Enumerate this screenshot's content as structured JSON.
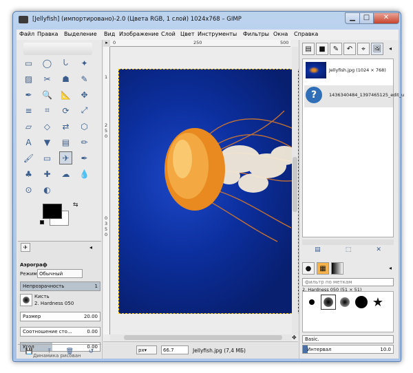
{
  "window": {
    "title": "[Jellyfish] (импортировано)-2.0 (Цвета RGB, 1 слой) 1024x768 – GIMP",
    "minimize": "▁",
    "maximize": "□",
    "close": "✕"
  },
  "menu": [
    "Файл",
    "Правка",
    "Выделение",
    "Вид",
    "Изображение",
    "Слой",
    "Цвет",
    "Инструменты",
    "Фильтры",
    "Окна",
    "Справка"
  ],
  "ruler": {
    "top": [
      "0",
      "250",
      "500"
    ],
    "left": [
      "1",
      "2",
      "5",
      "0",
      "0",
      "3",
      "5",
      "0"
    ]
  },
  "toolbox": {
    "icons": [
      "rect-select-icon",
      "ellipse-select-icon",
      "lasso-icon",
      "fuzzy-select-icon",
      "color-select-icon",
      "scissors-icon",
      "foreground-select-icon",
      "paths-icon",
      "color-picker-icon",
      "zoom-icon",
      "measure-icon",
      "move-icon",
      "align-icon",
      "crop-icon",
      "rotate-icon",
      "scale-icon",
      "shear-icon",
      "perspective-icon",
      "flip-icon",
      "cage-icon",
      "text-icon",
      "bucket-fill-icon",
      "blend-icon",
      "pencil-icon",
      "paintbrush-icon",
      "eraser-icon",
      "airbrush-icon",
      "ink-icon",
      "clone-icon",
      "heal-icon",
      "smudge-icon",
      "dodge-burn-icon",
      "unified-transform-icon",
      "warp-icon"
    ],
    "glyphs": [
      "▭",
      "◯",
      "ᘂ",
      "✦",
      "▨",
      "✂",
      "☗",
      "✎",
      "✒",
      "🔍",
      "📐",
      "✥",
      "≡",
      "⌗",
      "⟳",
      "⤢",
      "▱",
      "◇",
      "⇄",
      "⬡",
      "A",
      "▼",
      "▤",
      "✏",
      "🖌",
      "▭",
      "✈",
      "✒",
      "♣",
      "✚",
      "☁",
      "💧",
      "⊙",
      "◐"
    ],
    "options_title": "Аэрограф",
    "mode_label": "Режим:",
    "mode_value": "Обычный",
    "opacity_label": "Непрозрачность",
    "opacity_value": "1",
    "brush_label": "Кисть",
    "brush_value": "2. Hardness 050",
    "size_label": "Размер",
    "size_value": "20.00",
    "ratio_label": "Соотношение сто...",
    "ratio_value": "0.00",
    "angle_label": "Угол",
    "angle_value": "0.00",
    "dynamics_label": "Динамика рисован"
  },
  "canvas": {
    "status_unit": "px",
    "status_zoom": "66.7",
    "status_text": "Jellyfish.jpg (7,4 МБ)"
  },
  "dock": {
    "images": [
      {
        "name": "Jellyfish.jpg (1024 × 768)"
      },
      {
        "name": "1436340484_1397465125_edit_u"
      }
    ],
    "brush_filter": "фильтр по меткам",
    "brush_title": "2. Hardness 050 (51 × 51)",
    "preset": "Basic.",
    "spacing_label": "Интервал",
    "spacing_value": "10.0"
  }
}
